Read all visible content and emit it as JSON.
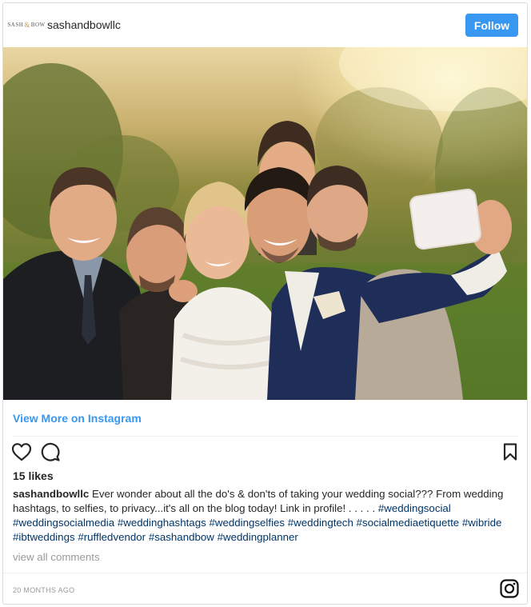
{
  "header": {
    "avatar_text_left": "SASH",
    "avatar_text_amp": "&",
    "avatar_text_right": "BOW",
    "username": "sashandbowllc",
    "follow_label": "Follow"
  },
  "photo": {
    "subject_icon": "wedding-selfie-photo"
  },
  "view_more_label": "View More on Instagram",
  "actions": {
    "like_icon": "heart-icon",
    "comment_icon": "comment-icon",
    "save_icon": "bookmark-icon"
  },
  "likes": "15 likes",
  "caption": {
    "username": "sashandbowllc",
    "text": " Ever wonder about all the do's & don'ts of taking your wedding social??? From wedding hashtags, to selfies, to privacy...it's all on the blog today! Link in profile! . . . . . ",
    "hashtags": [
      "#weddingsocial",
      "#weddingsocialmedia",
      "#weddinghashtags",
      "#weddingselfies",
      "#weddingtech",
      "#socialmediaetiquette",
      "#wibride",
      "#ibtweddings",
      "#ruffledvendor",
      "#sashandbow",
      "#weddingplanner"
    ]
  },
  "view_all_comments": "view all comments",
  "timestamp": "20 MONTHS AGO",
  "colors": {
    "accent": "#3897f0",
    "hashtag": "#003569",
    "muted": "#999999",
    "text": "#262626"
  }
}
